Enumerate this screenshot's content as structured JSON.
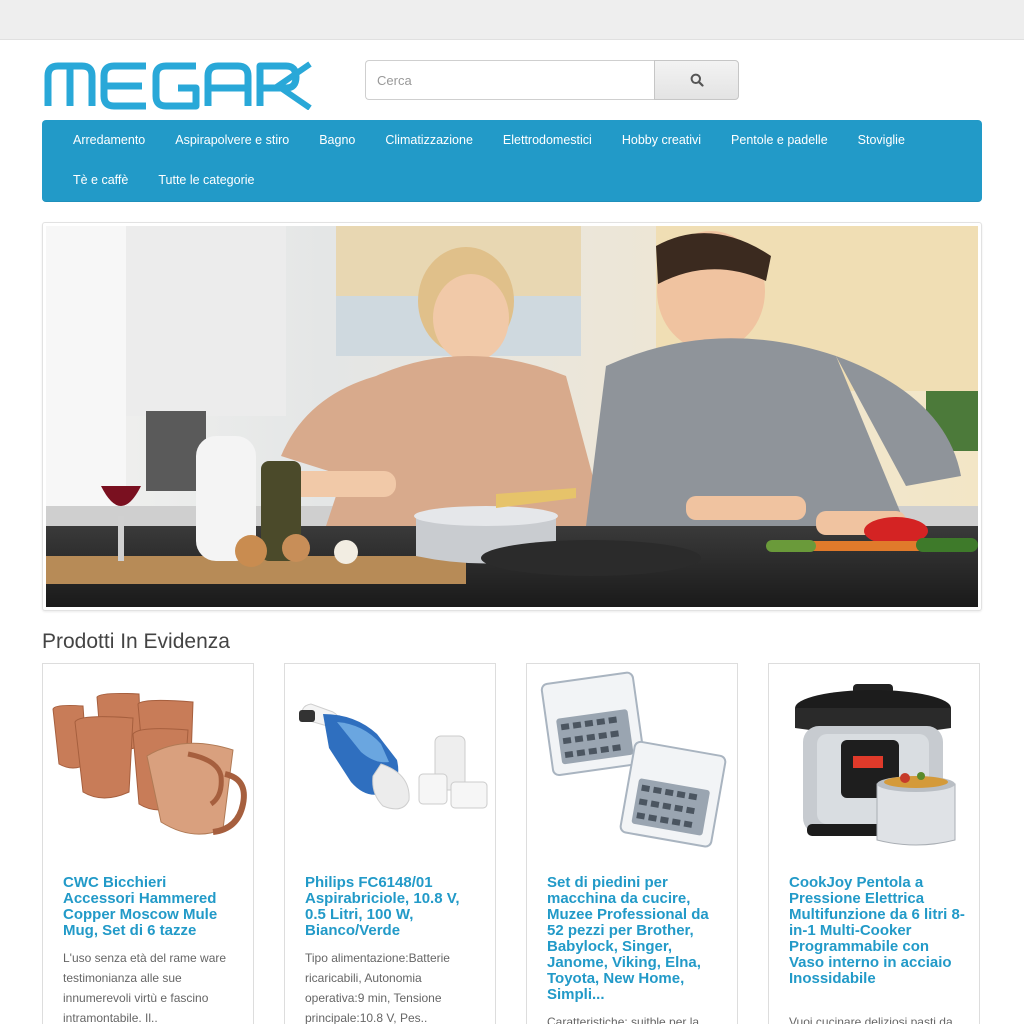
{
  "header": {
    "logo_text": "MEGAPK",
    "search": {
      "placeholder": "Cerca"
    }
  },
  "colors": {
    "brand": "#229ac8",
    "logo_cyan": "#29a8d8",
    "topbar": "#eeeeee",
    "product_title": "#229ac8"
  },
  "nav": {
    "row1": [
      "Arredamento",
      "Aspirapolvere e stiro",
      "Bagno",
      "Climatizzazione",
      "Elettrodomestici",
      "Hobby creativi",
      "Pentole e padelle",
      "Stoviglie"
    ],
    "row2": [
      "Tè e caffè",
      "Tutte le categorie"
    ]
  },
  "banner": {
    "icon": "kitchen-photo"
  },
  "featured": {
    "title": "Prodotti In Evidenza",
    "products": [
      {
        "title": "CWC Bicchieri Accessori Hammered Copper Moscow Mule Mug, Set di 6 tazze",
        "desc": "L'uso senza età del rame ware testimonianza alle sue innumerevoli virtù e fascino intramontabile. Il..",
        "icon": "copper-mugs-image"
      },
      {
        "title": "Philips FC6148/01 Aspirabriciole, 10.8 V, 0.5 Litri, 100 W, Bianco/Verde",
        "desc": "Tipo alimentazione:Batterie ricaricabili, Autonomia operativa:9 min, Tensione principale:10.8 V, Pes..",
        "icon": "handheld-vacuum-image"
      },
      {
        "title": "Set di piedini per macchina da cucire, Muzee Professional da 52 pezzi per Brother, Babylock, Singer, Janome, Viking, Elna, Toyota, New Home, Simpli...",
        "desc": "Caratteristiche: suitble per la",
        "icon": "sewing-feet-set-image"
      },
      {
        "title": "CookJoy Pentola a Pressione Elettrica Multifunzione da 6 litri 8-in-1 Multi-Cooker Programmabile con Vaso interno in acciaio Inossidabile",
        "desc": "Vuoi cucinare deliziosi pasti da",
        "icon": "pressure-cooker-image"
      }
    ]
  }
}
